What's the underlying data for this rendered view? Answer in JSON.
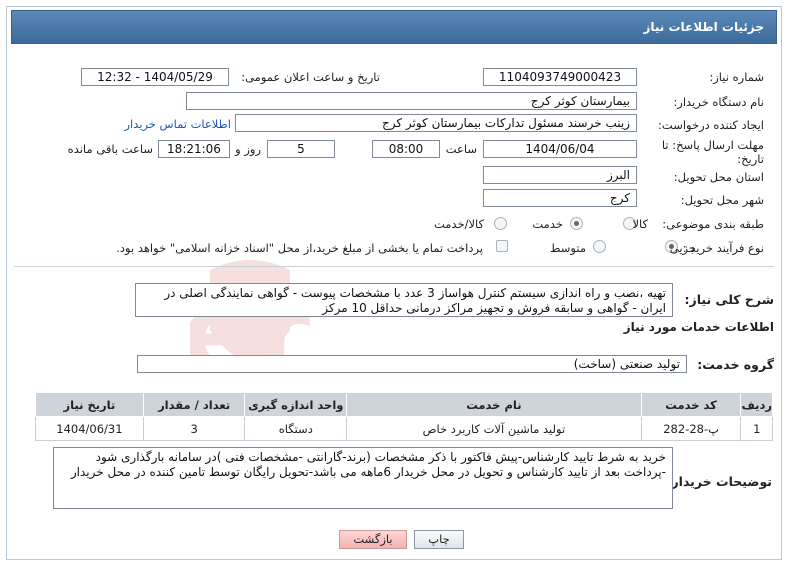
{
  "header": {
    "title": "جزئیات اطلاعات نیاز"
  },
  "fields": {
    "need_number_label": "شماره نیاز:",
    "need_number": "1104093749000423",
    "announce_label": "تاریخ و ساعت اعلان عمومی:",
    "announce_value": "1404/05/29 - 12:32",
    "buyer_org_label": "نام دستگاه خریدار:",
    "buyer_org": "بیمارستان کوثر کرج",
    "creator_label": "ایجاد کننده درخواست:",
    "creator": "زینب خرسند مسئول تدارکات بیمارستان کوثر کرج",
    "contact_link": "اطلاعات تماس خریدار",
    "deadline_label_1": "مهلت ارسال پاسخ: تا",
    "deadline_label_2": "تاریخ:",
    "deadline_date": "1404/06/04",
    "time_label": "ساعت",
    "deadline_time": "08:00",
    "days_value": "5",
    "days_label": "روز و",
    "remaining_time": "18:21:06",
    "remaining_label": "ساعت باقی مانده",
    "province_label": "استان محل تحویل:",
    "province": "البرز",
    "city_label": "شهر محل تحویل:",
    "city": "کرج",
    "category_label": "طبقه بندی موضوعی:",
    "category_options": [
      "کالا",
      "خدمت",
      "کالا/خدمت"
    ],
    "category_selected": 1,
    "purchase_type_label": "نوع فرآیند خرید :",
    "purchase_options": [
      "جزیی",
      "متوسط"
    ],
    "purchase_selected": 0,
    "payment_note": "پرداخت تمام یا بخشی از مبلغ خرید،از محل \"اسناد خزانه اسلامی\" خواهد بود."
  },
  "description": {
    "label": "شرح کلی نیاز:",
    "text": "تهیه ،نصب و راه اندازی سیستم کنترل هواساز 3 عدد با مشخصات پیوست - گواهی نمایندگی اصلی در ایران - گواهی و سابقه فروش و تجهیز مراکز درمانی حداقل 10 مرکز"
  },
  "services": {
    "section_title": "اطلاعات خدمات مورد نیاز",
    "group_label": "گروه خدمت:",
    "group_value": "تولید صنعتی (ساخت)",
    "columns": [
      "ردیف",
      "کد خدمت",
      "نام خدمت",
      "واحد اندازه گیری",
      "تعداد / مقدار",
      "تاریخ نیاز"
    ],
    "rows": [
      [
        "1",
        "پ-28-282",
        "تولید ماشین آلات کاربرد خاص",
        "دستگاه",
        "3",
        "1404/06/31"
      ]
    ]
  },
  "buyer_notes": {
    "label": "توضیحات خریدار:",
    "text": "خرید به شرط تایید کارشناس-پیش فاکتور با ذکر مشخصات (برند-گارانتی -مشخصات فنی )در سامانه بارگذاری شود -پرداخت بعد از تایید کارشناس و تحویل در محل خریدار 6ماهه می باشد-تحویل رایگان توسط تامین کننده در محل خریدار"
  },
  "buttons": {
    "print": "چاپ",
    "back": "بازگشت"
  },
  "colors": {
    "header": "#4a78a8",
    "link": "#1a57b8",
    "back_button": "#f3b3b3"
  }
}
